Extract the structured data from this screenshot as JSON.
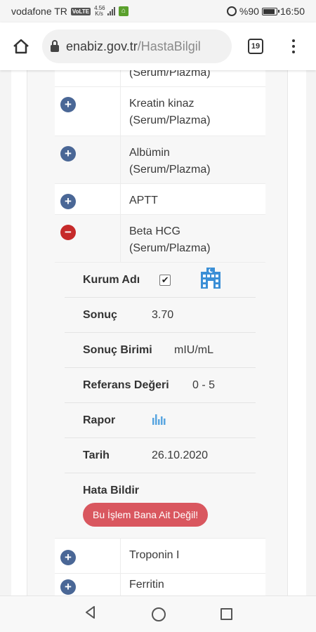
{
  "status_bar": {
    "carrier": "vodafone TR",
    "volte": "VoLTE",
    "net_speed": "4.56",
    "net_unit": "K/s",
    "battery_text": "%90",
    "battery_level": 0.9,
    "time": "16:50"
  },
  "browser": {
    "url_host": "enabiz.gov.tr",
    "url_path": "/HastaBilgil",
    "tab_count": "19"
  },
  "tests": [
    {
      "name": "(Serum/Plazma)",
      "state": "partial"
    },
    {
      "name": "Kreatin kinaz (Serum/Plazma)",
      "state": "collapsed"
    },
    {
      "name": "Albümin (Serum/Plazma)",
      "state": "collapsed"
    },
    {
      "name": "APTT",
      "state": "collapsed"
    },
    {
      "name": "Beta HCG (Serum/Plazma)",
      "state": "expanded"
    }
  ],
  "detail": {
    "kurum_label": "Kurum Adı",
    "kurum_checked": true,
    "sonuc_label": "Sonuç",
    "sonuc_value": "3.70",
    "birim_label": "Sonuç Birimi",
    "birim_value": "mIU/mL",
    "referans_label": "Referans Değeri",
    "referans_value": "0 - 5",
    "rapor_label": "Rapor",
    "tarih_label": "Tarih",
    "tarih_value": "26.10.2020",
    "hata_label": "Hata Bildir",
    "hata_button": "Bu İşlem Bana Ait Değil!"
  },
  "tests_after": [
    {
      "name": "Troponin I",
      "state": "collapsed"
    },
    {
      "name": "Ferritin",
      "state": "collapsed"
    }
  ],
  "icons": {
    "plus": "+",
    "minus": "−",
    "check": "✔"
  },
  "colors": {
    "plus_button": "#4a6796",
    "minus_button": "#c62a2a",
    "error_button": "#d9575f",
    "hospital_icon": "#3b8fd6"
  }
}
